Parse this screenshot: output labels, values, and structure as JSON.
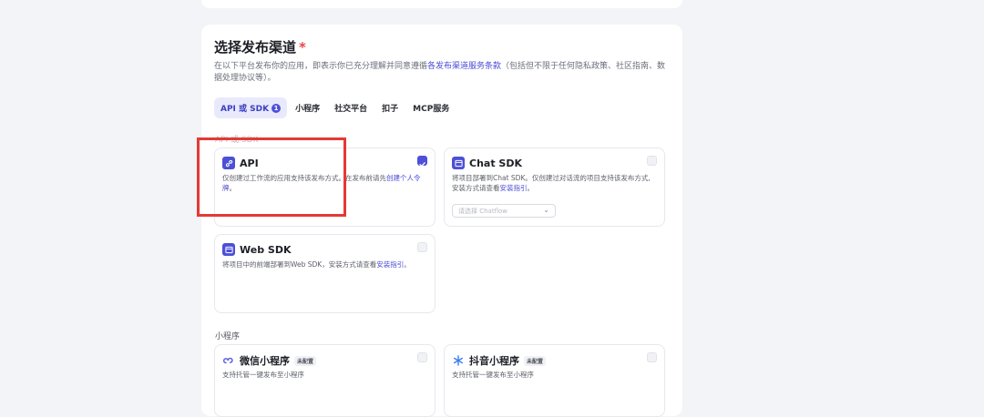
{
  "section": {
    "title": "选择发布渠道",
    "required_mark": "*",
    "description_pre": "在以下平台发布你的应用，即表示你已充分理解并同意遵循",
    "description_link": "各发布渠道服务条款",
    "description_post": "（包括但不限于任何隐私政策、社区指南、数据处理协议等）。"
  },
  "tabs": [
    {
      "label": "API 或 SDK",
      "badge": "1"
    },
    {
      "label": "小程序"
    },
    {
      "label": "社交平台"
    },
    {
      "label": "扣子"
    },
    {
      "label": "MCP服务"
    }
  ],
  "api_sdk_group": {
    "label": "API 或 SDK",
    "cards": {
      "api": {
        "title": "API",
        "desc_pre": "仅创建过工作流的应用支持该发布方式。在发布前请先",
        "desc_link": "创建个人令牌",
        "desc_post": "。",
        "checked": true
      },
      "chat_sdk": {
        "title": "Chat SDK",
        "desc_pre": "将项目部署到Chat SDK。仅创建过对话流的项目支持该发布方式,安装方式请查看",
        "desc_link": "安装指引",
        "desc_post": "。",
        "select_placeholder": "请选择 Chatflow",
        "checked": false
      },
      "web_sdk": {
        "title": "Web SDK",
        "desc_pre": "将项目中的前端部署到Web SDK，安装方式请查看",
        "desc_link": "安装指引",
        "desc_post": "。",
        "checked": false
      }
    }
  },
  "mini_group": {
    "label": "小程序",
    "cards": {
      "wechat": {
        "title": "微信小程序",
        "tag": "未配置",
        "desc": "支持托管一键发布至小程序",
        "checked": false
      },
      "douyin": {
        "title": "抖音小程序",
        "tag": "未配置",
        "desc": "支持托管一键发布至小程序",
        "checked": false
      }
    }
  },
  "colors": {
    "accent": "#4d50d8",
    "highlight": "#e53935"
  }
}
